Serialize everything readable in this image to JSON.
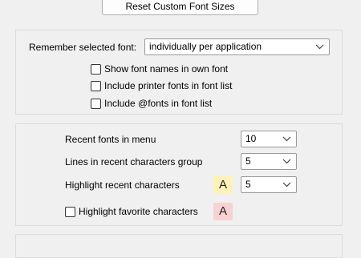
{
  "reset_button": {
    "label": "Reset Custom Font Sizes"
  },
  "font_group": {
    "remember_label": "Remember selected font:",
    "remember_value": "individually per application",
    "show_names_label": "Show font names in own font",
    "show_names_checked": false,
    "printer_fonts_label": "Include printer fonts in font list",
    "printer_fonts_checked": false,
    "at_fonts_label": "Include @fonts in font list",
    "at_fonts_checked": false
  },
  "recent_group": {
    "recent_fonts_label": "Recent fonts in menu",
    "recent_fonts_value": "10",
    "lines_label": "Lines in recent characters group",
    "lines_value": "5",
    "highlight_recent_label": "Highlight recent characters",
    "highlight_recent_sample": "A",
    "highlight_recent_value": "5",
    "highlight_recent_color": "#fff2b8",
    "highlight_fav_label": "Highlight favorite characters",
    "highlight_fav_checked": false,
    "highlight_fav_sample": "A",
    "highlight_fav_color": "#f8d2d2"
  },
  "icons": {
    "dropdown": "chevron-down-icon",
    "checkbox": "checkbox-icon"
  }
}
